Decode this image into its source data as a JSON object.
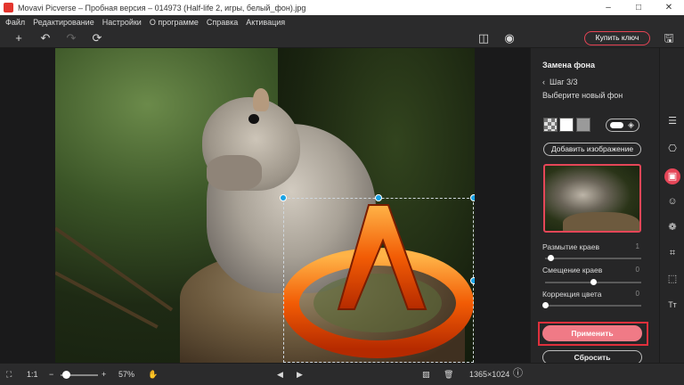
{
  "window": {
    "title": "Movavi Picverse – Пробная версия – 014973 (Half-life 2, игры, белый_фон).jpg",
    "minimize": "–",
    "maximize": "□",
    "close": "✕"
  },
  "menu": [
    "Файл",
    "Редактирование",
    "Настройки",
    "О программе",
    "Справка",
    "Активация"
  ],
  "toolbar": {
    "add_icon": "+",
    "undo_icon": "↶",
    "redo_icon": "↷",
    "rotate_icon": "⟳",
    "compare_icon": "◫",
    "preview_icon": "◉",
    "buy_label": "Купить ключ",
    "save_icon": "🖫"
  },
  "panel": {
    "title": "Замена фона",
    "step": "Шаг 3/3",
    "back_icon": "‹",
    "subtitle": "Выберите новый фон",
    "add_image_label": "Добавить изображение",
    "fill_icon": "◈",
    "sliders": [
      {
        "label": "Размытие краев",
        "value": "1",
        "fraction": 0.06
      },
      {
        "label": "Смещение краев",
        "value": "0",
        "fraction": 0.5
      },
      {
        "label": "Коррекция цвета",
        "value": "0",
        "fraction": 0.0
      }
    ],
    "apply_label": "Применить",
    "reset_label": "Сбросить"
  },
  "rail_icons": [
    "adjust-icon",
    "stamp-icon",
    "background-icon",
    "face-icon",
    "filters-icon",
    "crop-icon",
    "select-icon",
    "text-icon"
  ],
  "rail_glyphs": [
    "☰",
    "⎔",
    "▣",
    "☺",
    "❁",
    "⌗",
    "⬚",
    "Tт"
  ],
  "bottombar": {
    "fit_icon": "⛶",
    "ratio_label": "1:1",
    "zoom_out_icon": "−",
    "zoom_in_icon": "+",
    "zoom_value": "57%",
    "zoom_fraction": 0.15,
    "hand_icon": "✋",
    "prev_icon": "◀",
    "next_icon": "▶",
    "image_icon": "▨",
    "delete_icon": "🗑",
    "dimensions": "1365×1024",
    "info_icon": "ⓘ"
  },
  "colors": {
    "accent": "#e54658",
    "selection_handle": "#19a3e6",
    "apply_button": "#f07a86"
  }
}
